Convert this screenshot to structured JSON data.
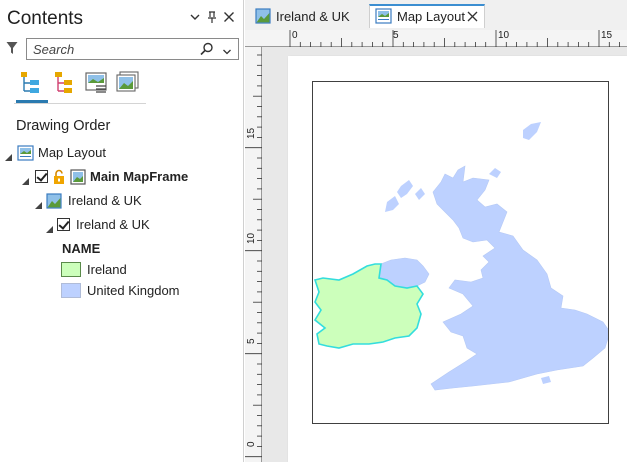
{
  "contents": {
    "title": "Contents",
    "search": {
      "placeholder": "Search"
    },
    "section_title": "Drawing Order",
    "tree": {
      "map_layout": "Map Layout",
      "main_mapframe": "Main MapFrame",
      "map": "Ireland & UK",
      "layer": "Ireland & UK",
      "field_header": "NAME",
      "legend": [
        {
          "label": "Ireland",
          "color": "#ccffbb"
        },
        {
          "label": "United Kingdom",
          "color": "#bdd1ff"
        }
      ]
    }
  },
  "tabs": [
    {
      "label": "Ireland & UK"
    },
    {
      "label": "Map Layout"
    }
  ],
  "ruler": {
    "top": [
      "0",
      "5",
      "10",
      "15"
    ],
    "left": [
      "15",
      "10",
      "5",
      "0"
    ]
  },
  "colors": {
    "ireland_fill": "#ccffbb",
    "ireland_outline": "#33dddd",
    "uk_fill": "#bdd1ff",
    "accent": "#2a7ab0"
  }
}
